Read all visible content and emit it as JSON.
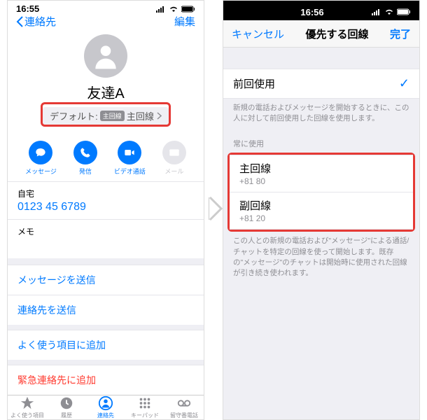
{
  "left": {
    "time": "16:55",
    "back": "連絡先",
    "edit": "編集",
    "name": "友達A",
    "default_prefix": "デフォルト:",
    "default_badge": "主回線",
    "default_line": "主回線",
    "actions": {
      "msg": "メッセージ",
      "call": "発信",
      "video": "ビデオ通話",
      "mail": "メール"
    },
    "home_lbl": "自宅",
    "home_num": "0123 45 6789",
    "memo": "メモ",
    "links": {
      "send_msg": "メッセージを送信",
      "send_contact": "連絡先を送信",
      "fav": "よく使う項目に追加",
      "emerg": "緊急連絡先に追加"
    },
    "tabs": {
      "fav": "よく使う項目",
      "recent": "履歴",
      "contacts": "連絡先",
      "keypad": "キーパッド",
      "vm": "留守番電話"
    }
  },
  "right": {
    "time": "16:56",
    "cancel": "キャンセル",
    "title": "優先する回線",
    "done": "完了",
    "last_used": "前回使用",
    "note1": "新規の電話およびメッセージを開始するときに、この人に対して前回使用した回線を使用します。",
    "always": "常に使用",
    "line1_t": "主回線",
    "line1_s": "+81 80",
    "line2_t": "副回線",
    "line2_s": "+81 20",
    "note2": "この人との新規の電話および\"メッセージ\"による通話/チャットを特定の回線を使って開始します。既存の\"メッセージ\"のチャットは開始時に使用された回線が引き続き使われます。"
  }
}
